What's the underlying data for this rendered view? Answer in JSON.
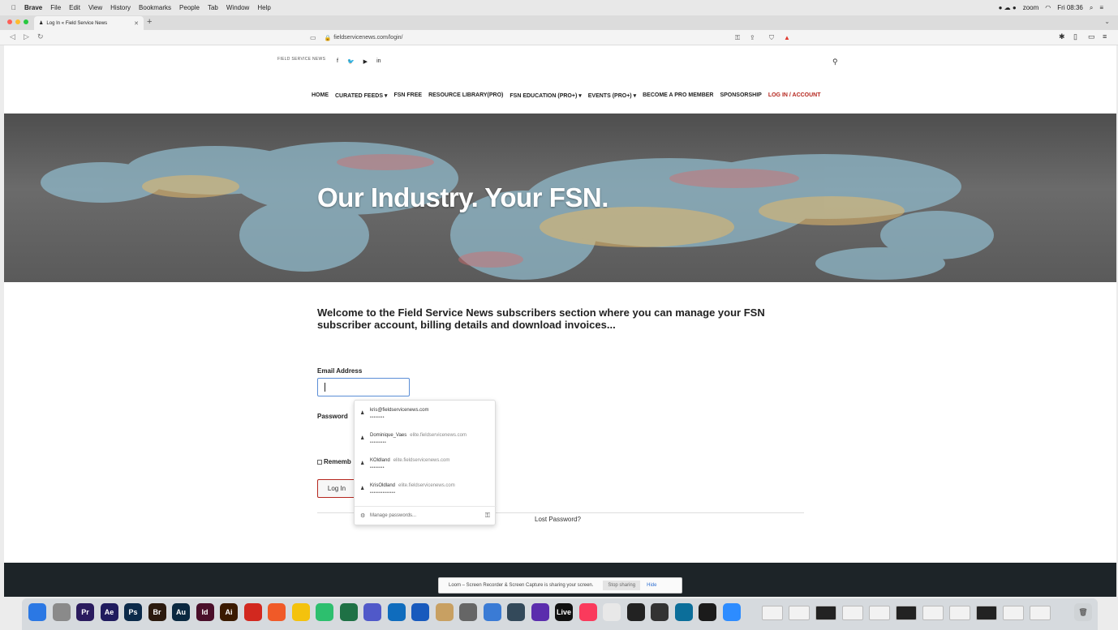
{
  "os_menubar": {
    "app_name": "Brave",
    "menus": [
      "File",
      "Edit",
      "View",
      "History",
      "Bookmarks",
      "People",
      "Tab",
      "Window",
      "Help"
    ],
    "status_zoom": "zoom",
    "clock": "Fri 08:36"
  },
  "browser": {
    "tab_title": "Log In « Field Service News",
    "url": "fieldservicenews.com/login/"
  },
  "site": {
    "logo_text": "FIELD SERVICE NEWS",
    "socials": [
      "f",
      "t",
      "yt",
      "in"
    ],
    "nav": [
      {
        "label": "HOME"
      },
      {
        "label": "CURATED FEEDS ▾"
      },
      {
        "label": "FSN FREE"
      },
      {
        "label": "RESOURCE LIBRARY(PRO)"
      },
      {
        "label": "FSN EDUCATION (PRO+) ▾"
      },
      {
        "label": "EVENTS (PRO+) ▾"
      },
      {
        "label": "BECOME A PRO MEMBER"
      },
      {
        "label": "SPONSORSHIP"
      },
      {
        "label": "LOG IN / ACCOUNT"
      }
    ],
    "hero_title": "Our Industry. Your FSN."
  },
  "login": {
    "welcome": "Welcome to the Field Service News subscribers section where you can manage your FSN subscriber account, billing details and download invoices...",
    "email_label": "Email Address",
    "email_value": "",
    "password_label": "Password",
    "remember_label": "Rememb",
    "login_button": "Log In",
    "lost_password": "Lost Password?"
  },
  "password_autofill": {
    "entries": [
      {
        "user": "kris@fieldservicenews.com",
        "site": "",
        "mask": "••••••••"
      },
      {
        "user": "Dominique_Vaes",
        "site": "elite.fieldservicenews.com",
        "mask": "•••••••••"
      },
      {
        "user": "KOldland",
        "site": "elite.fieldservicenews.com",
        "mask": "••••••••"
      },
      {
        "user": "KrisOldland",
        "site": "elite.fieldservicenews.com",
        "mask": "••••••••••••••"
      }
    ],
    "manage_label": "Manage passwords..."
  },
  "screen_share_bar": {
    "message": "Loom – Screen Recorder & Screen Capture is sharing your screen.",
    "stop_label": "Stop sharing",
    "hide_label": "Hide"
  },
  "dock": {
    "apps": [
      {
        "label": "",
        "color": "#2b78e4",
        "icon": "finder-icon"
      },
      {
        "label": "",
        "color": "#8a8a8a",
        "icon": "system-preferences-icon"
      },
      {
        "label": "Pr",
        "color": "#2a1b5e",
        "icon": "premiere-icon"
      },
      {
        "label": "Ae",
        "color": "#1f1b5e",
        "icon": "after-effects-icon"
      },
      {
        "label": "Ps",
        "color": "#0b2a4a",
        "icon": "photoshop-icon"
      },
      {
        "label": "Br",
        "color": "#2b1a0e",
        "icon": "bridge-icon"
      },
      {
        "label": "Au",
        "color": "#0a2840",
        "icon": "audition-icon"
      },
      {
        "label": "Id",
        "color": "#4a0f2a",
        "icon": "indesign-icon"
      },
      {
        "label": "Ai",
        "color": "#3a1a00",
        "icon": "illustrator-icon"
      },
      {
        "label": "",
        "color": "#d2281f",
        "icon": "acrobat-icon"
      },
      {
        "label": "",
        "color": "#f05a28",
        "icon": "brave-icon"
      },
      {
        "label": "",
        "color": "#f4c20d",
        "icon": "chrome-icon"
      },
      {
        "label": "",
        "color": "#2dbf6e",
        "icon": "grammarly-icon"
      },
      {
        "label": "",
        "color": "#1e7145",
        "icon": "excel-icon"
      },
      {
        "label": "",
        "color": "#5059c9",
        "icon": "teams-icon"
      },
      {
        "label": "",
        "color": "#0f6cbd",
        "icon": "outlook-icon"
      },
      {
        "label": "",
        "color": "#185abd",
        "icon": "word-icon"
      },
      {
        "label": "",
        "color": "#c8a062",
        "icon": "notes-icon"
      },
      {
        "label": "",
        "color": "#666666",
        "icon": "disk-utility-icon"
      },
      {
        "label": "",
        "color": "#3a7bd5",
        "icon": "safari-icon"
      },
      {
        "label": "",
        "color": "#33495a",
        "icon": "console-icon"
      },
      {
        "label": "",
        "color": "#5b2dad",
        "icon": "avid-icon"
      },
      {
        "label": "Live",
        "color": "#111111",
        "icon": "ableton-icon"
      },
      {
        "label": "",
        "color": "#fa3a5c",
        "icon": "music-icon"
      },
      {
        "label": "",
        "color": "#e8e8e8",
        "icon": "piano-icon"
      },
      {
        "label": "",
        "color": "#222222",
        "icon": "xbox-icon"
      },
      {
        "label": "",
        "color": "#333333",
        "icon": "obs-icon"
      },
      {
        "label": "",
        "color": "#0b6e9a",
        "icon": "loom-icon"
      },
      {
        "label": "",
        "color": "#1b1b1b",
        "icon": "terminal-icon"
      },
      {
        "label": "",
        "color": "#2d8cff",
        "icon": "zoom-icon"
      }
    ]
  }
}
